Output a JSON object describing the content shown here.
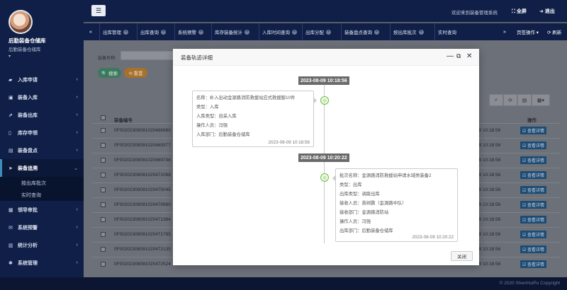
{
  "sidebar": {
    "user_name": "后勤装备仓储库",
    "user_sub": "后勤装备仓储库",
    "items": [
      {
        "label": "入库申请",
        "icon": "▰",
        "icon_name": "book-icon"
      },
      {
        "label": "装备入库",
        "icon": "▣",
        "icon_name": "inbox-icon"
      },
      {
        "label": "装备出库",
        "icon": "⇗",
        "icon_name": "external-link-icon"
      },
      {
        "label": "库存申领",
        "icon": "▯",
        "icon_name": "file-icon"
      },
      {
        "label": "装备盘点",
        "icon": "▤",
        "icon_name": "list-icon"
      },
      {
        "label": "装备追溯",
        "icon": "➤",
        "icon_name": "send-icon"
      },
      {
        "label": "领导审批",
        "icon": "▦",
        "icon_name": "table-icon"
      },
      {
        "label": "系统预警",
        "icon": "✉",
        "icon_name": "bullhorn-icon"
      },
      {
        "label": "统计分析",
        "icon": "▥",
        "icon_name": "bar-chart-icon"
      },
      {
        "label": "系统管理",
        "icon": "✱",
        "icon_name": "gear-icon"
      }
    ],
    "submenu": [
      "按出库批次",
      "实时查询"
    ]
  },
  "topbar": {
    "welcome": "欢迎来到装备管理系统",
    "fullscreen": "⛶ 全屏",
    "logout": "➜ 退出"
  },
  "tabs": [
    "出库管理",
    "出库查询",
    "系统预警",
    "库存装备统计",
    "入库时间查询",
    "出库分配",
    "装备盘点查询",
    "按出库批次",
    "实时查询"
  ],
  "tab_right": {
    "page_ops": "页签操作 ▾",
    "refresh": "⟳ 刷新"
  },
  "main": {
    "search_label": "装备名称:",
    "search_button": "🔍 搜索",
    "reset_button": "⟲ 重置",
    "col_code": "装备编号",
    "col_op": "操作",
    "rows": [
      {
        "code": "0F00202308091020466980",
        "time": "09 10:18:56",
        "op": "☑ 查看详情"
      },
      {
        "code": "0F00202308091020469377",
        "time": "09 10:18:56",
        "op": "☑ 查看详情"
      },
      {
        "code": "0F00202308091020469748",
        "time": "09 10:18:56",
        "op": "☑ 查看详情"
      },
      {
        "code": "0F00202308091020471098",
        "time": "09 10:18:56",
        "op": "☑ 查看详情"
      },
      {
        "code": "0F00202308091020475045",
        "time": "09 10:18:56",
        "op": "☑ 查看详情"
      },
      {
        "code": "0F00202308091020479980",
        "time": "09 10:18:56",
        "op": "☑ 查看详情"
      },
      {
        "code": "0F00202308091020471384",
        "time": "09 10:18:56",
        "op": "☑ 查看详情"
      },
      {
        "code": "0F00202308091020471785",
        "time": "09 10:18:56",
        "op": "☑ 查看详情"
      },
      {
        "code": "0F00202308091020472135",
        "time": "09 10:18:56",
        "op": "☑ 查看详情"
      },
      {
        "code": "0F00202308091020472524",
        "time": "09 10:18:56",
        "op": "☑ 查看详情"
      }
    ]
  },
  "footer": "© 2020 ShenHuiPu Copyright",
  "modal": {
    "title": "装备轨迹详细",
    "close_button": "关闭",
    "events": [
      {
        "date": "2023-08-09 10:18:56",
        "lines": [
          "名称：补入出动金源路消防救援站应式救援服10件",
          "类型：入库",
          "入库类型：自采入库",
          "操作人员：冯强",
          "入库部门：后勤装备仓储库"
        ],
        "card_time": "2023-08-09 10:18:56"
      },
      {
        "date": "2023-08-09 10:20:22",
        "lines": [
          "批次名称：金源路消防救援站申请水域类装备2",
          "类型：出库",
          "出库类型：调拨出库",
          "接收人员：苗树鹏（金源路中队）",
          "接收部门：金源路消防站",
          "操作人员：冯强",
          "出库部门：后勤装备仓储库"
        ],
        "card_time": "2023-08-09 10:20:22"
      }
    ]
  }
}
